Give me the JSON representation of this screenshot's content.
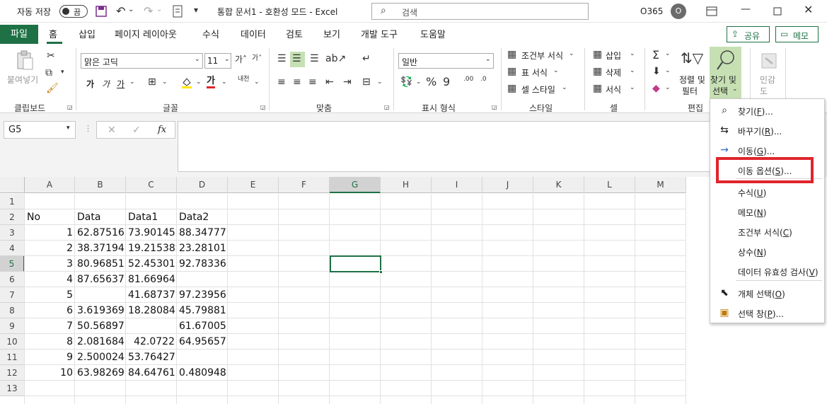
{
  "titlebar": {
    "autosave_label": "자동 저장",
    "autosave_state": "끔",
    "doc_title": "통합 문서1  -  호환성 모드  -  Excel",
    "search_placeholder": "검색",
    "account": "O365",
    "avatar_letter": "O"
  },
  "tabs": [
    "파일",
    "홈",
    "삽입",
    "페이지 레이아웃",
    "수식",
    "데이터",
    "검토",
    "보기",
    "개발 도구",
    "도움말"
  ],
  "share_label": "공유",
  "memo_label": "메모",
  "ribbon": {
    "clipboard": {
      "paste": "붙여넣기",
      "group": "클립보드"
    },
    "font": {
      "name": "맑은 고딕",
      "size": "11",
      "bold": "가",
      "italic": "가",
      "underline": "가",
      "group": "글꼴"
    },
    "align": {
      "group": "맞춤"
    },
    "number": {
      "format": "일반",
      "group": "표시 형식"
    },
    "style": {
      "cond": "조건부 서식",
      "table": "표 서식",
      "cell": "셀 스타일",
      "group": "스타일"
    },
    "cells": {
      "insert": "삽입",
      "delete": "삭제",
      "format": "서식",
      "group": "셀"
    },
    "edit": {
      "sort_l1": "정렬 및",
      "sort_l2": "필터",
      "find_l1": "찾기 및",
      "find_l2": "선택",
      "group": "편집"
    },
    "sensitivity": {
      "l1": "민감",
      "l2": "도"
    }
  },
  "formula": {
    "namebox": "G5",
    "fx": "fx"
  },
  "columns": [
    "A",
    "B",
    "C",
    "D",
    "E",
    "F",
    "G",
    "H",
    "I",
    "J",
    "K",
    "L",
    "M"
  ],
  "rows": [
    "1",
    "2",
    "3",
    "4",
    "5",
    "6",
    "7",
    "8",
    "9",
    "10",
    "11",
    "12",
    "13"
  ],
  "headers": [
    "No",
    "Data",
    "Data1",
    "Data2"
  ],
  "data": [
    [
      "1",
      "62.87516",
      "73.90145",
      "88.34777"
    ],
    [
      "2",
      "38.37194",
      "19.21538",
      "23.28101"
    ],
    [
      "3",
      "80.96851",
      "52.45301",
      "92.78336"
    ],
    [
      "4",
      "87.65637",
      "81.66964",
      ""
    ],
    [
      "5",
      "",
      "41.68737",
      "97.23956"
    ],
    [
      "6",
      "3.619369",
      "18.28084",
      "45.79881"
    ],
    [
      "7",
      "50.56897",
      "",
      "61.67005"
    ],
    [
      "8",
      "2.081684",
      "42.0722",
      "64.95657"
    ],
    [
      "9",
      "2.500024",
      "53.76427",
      ""
    ],
    [
      "10",
      "63.98269",
      "84.64761",
      "0.480948"
    ]
  ],
  "menu": {
    "items": [
      {
        "label": "찾기(",
        "key": "F",
        "tail": ")..."
      },
      {
        "label": "바꾸기(",
        "key": "R",
        "tail": ")..."
      },
      {
        "label": "이동(",
        "key": "G",
        "tail": ")..."
      },
      {
        "label": "이동 옵션(",
        "key": "S",
        "tail": ")..."
      },
      {
        "label": "수식(",
        "key": "U",
        "tail": ")"
      },
      {
        "label": "메모(",
        "key": "N",
        "tail": ")"
      },
      {
        "label": "조건부 서식(",
        "key": "C",
        "tail": ")"
      },
      {
        "label": "상수(",
        "key": "N",
        "tail": ")"
      },
      {
        "label": "데이터 유효성 검사(",
        "key": "V",
        "tail": ")"
      },
      {
        "label": "개체 선택(",
        "key": "O",
        "tail": ")"
      },
      {
        "label": "선택 창(",
        "key": "P",
        "tail": ")..."
      }
    ]
  },
  "colors": {
    "excel_green": "#217346",
    "highlight_red": "#e0242b",
    "selection_green": "#1e7145"
  }
}
